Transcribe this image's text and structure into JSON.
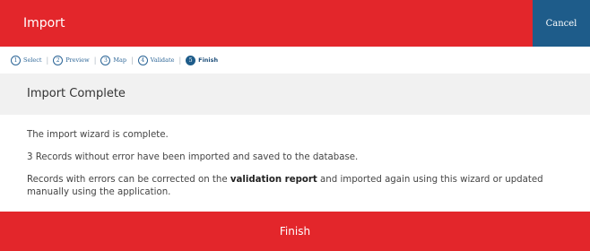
{
  "header": {
    "title": "Import",
    "cancel_label": "Cancel"
  },
  "steps": [
    {
      "num": "1",
      "label": "Select"
    },
    {
      "num": "2",
      "label": "Preview"
    },
    {
      "num": "3",
      "label": "Map"
    },
    {
      "num": "4",
      "label": "Validate"
    },
    {
      "num": "5",
      "label": "Finish"
    }
  ],
  "step_separator": "|",
  "section": {
    "title": "Import Complete"
  },
  "body": {
    "line1": "The import wizard is complete.",
    "line2": "3 Records without error have been imported and saved to the database.",
    "line3_before": "Records with errors can be corrected on the ",
    "line3_link": "validation report",
    "line3_after": " and imported again using this wizard or updated manually using the application."
  },
  "footer": {
    "finish_label": "Finish"
  },
  "colors": {
    "brand_red": "#e3262b",
    "cancel_blue": "#1e5c8a",
    "active_step": "#1e5c8a"
  }
}
